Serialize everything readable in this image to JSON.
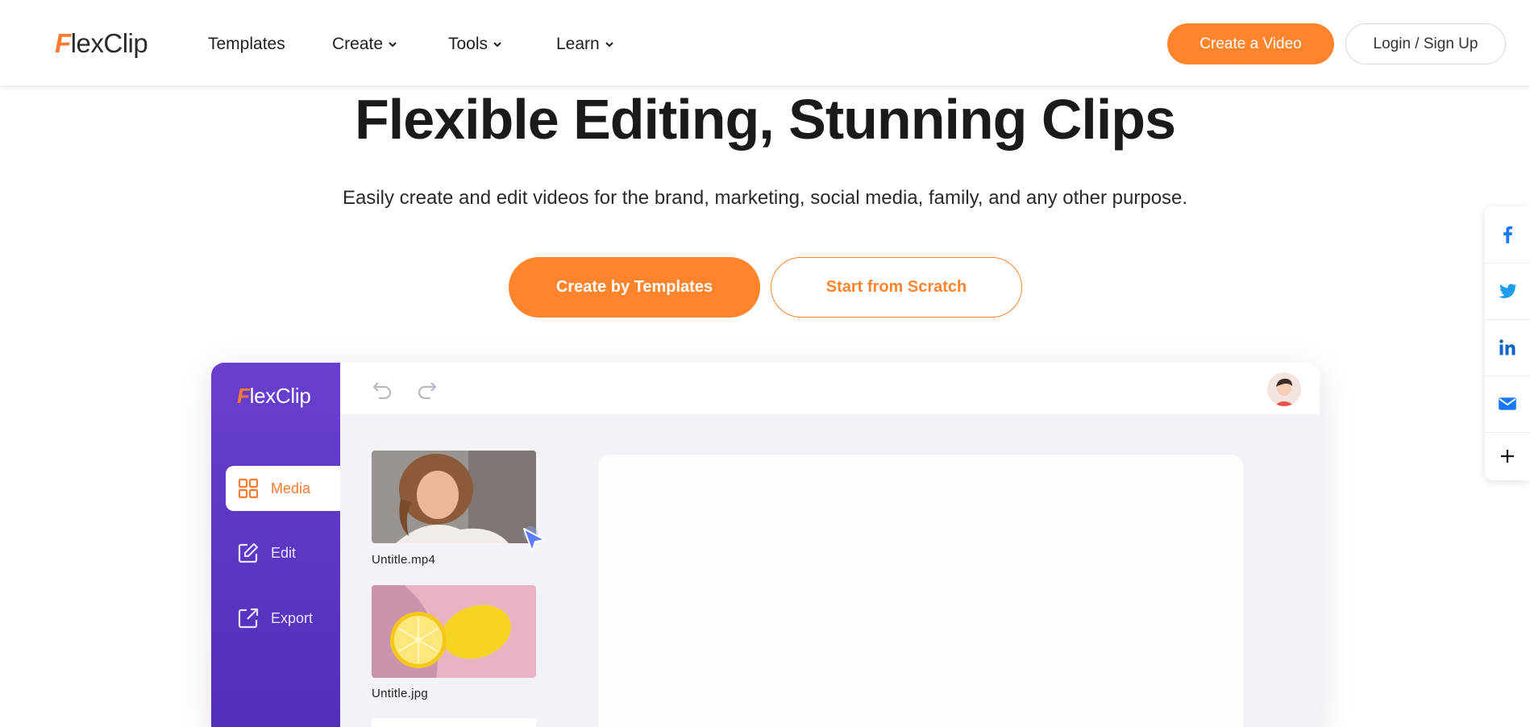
{
  "header": {
    "logo_first": "F",
    "logo_rest": "lexClip",
    "nav": [
      {
        "label": "Templates",
        "has_dropdown": false
      },
      {
        "label": "Create",
        "has_dropdown": true
      },
      {
        "label": "Tools",
        "has_dropdown": true
      },
      {
        "label": "Learn",
        "has_dropdown": true
      }
    ],
    "create_video_label": "Create a Video",
    "login_label": "Login / Sign Up"
  },
  "hero": {
    "title": "Flexible Editing, Stunning Clips",
    "subtitle": "Easily create and edit videos for the brand, marketing, social media, family, and any other purpose.",
    "primary_cta": "Create by Templates",
    "secondary_cta": "Start from Scratch"
  },
  "editor": {
    "logo_first": "F",
    "logo_rest": "lexClip",
    "tabs": [
      {
        "label": "Media",
        "icon": "grid-icon",
        "active": true
      },
      {
        "label": "Edit",
        "icon": "edit-icon",
        "active": false
      },
      {
        "label": "Export",
        "icon": "export-icon",
        "active": false
      }
    ],
    "media_items": [
      {
        "label": "Untitle.mp4",
        "kind": "video"
      },
      {
        "label": "Untitle.jpg",
        "kind": "image"
      }
    ]
  },
  "share": {
    "items": [
      "facebook-icon",
      "twitter-icon",
      "linkedin-icon",
      "email-icon",
      "plus-icon"
    ]
  },
  "colors": {
    "accent": "#ff842c",
    "sidebar_purple": "#5b35c4",
    "social_blue": "#1877f2"
  }
}
